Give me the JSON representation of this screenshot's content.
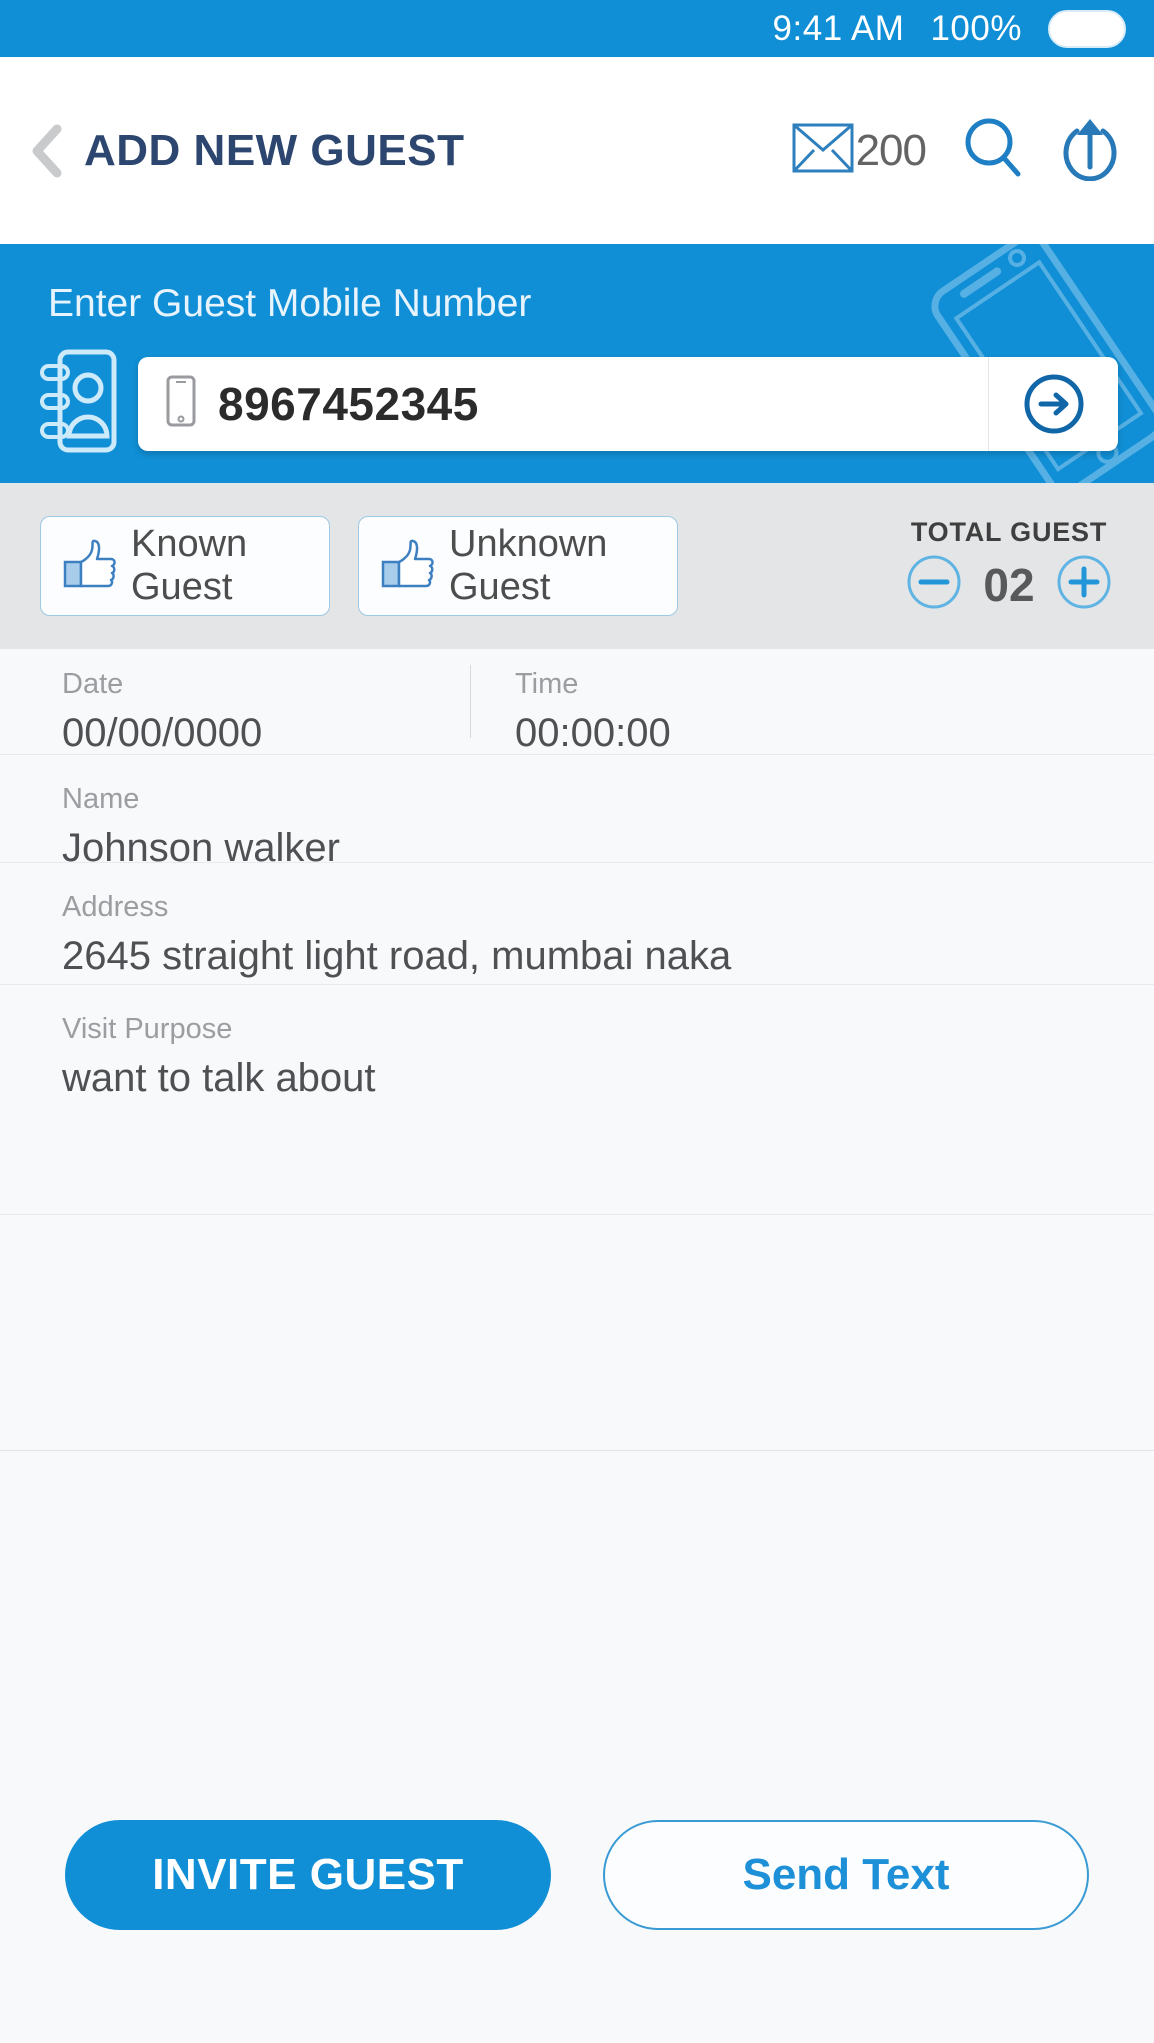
{
  "status_bar": {
    "time": "9:41 AM",
    "battery_percent": "100%",
    "battery_icon": "battery-full-icon",
    "background_color": "#108fd6"
  },
  "header": {
    "back_icon": "back-chevron-icon",
    "title": "ADD NEW GUEST",
    "title_color": "#2c4670",
    "mail_icon": "envelope-icon",
    "mail_count": "200",
    "search_icon": "search-icon",
    "share_icon": "upload-share-icon"
  },
  "mobile_panel": {
    "background_color": "#108fd6",
    "label": "Enter Guest Mobile Number",
    "contact_book_icon": "contact-book-icon",
    "phone_decoration_icon": "tilted-phone-outline-icon",
    "input_icon": "mobile-phone-icon",
    "input_value": "8967452345",
    "input_placeholder": "Enter Guest Mobile Number",
    "submit_icon": "arrow-right-circle-icon"
  },
  "guest_type": {
    "background_color": "#e4e5e7",
    "known_icon": "thumbs-up-icon",
    "known_label": "Known Guest",
    "unknown_icon": "thumbs-up-icon",
    "unknown_label": "Unknown Guest",
    "counter_title": "TOTAL GUEST",
    "decrement_icon": "minus-circle-icon",
    "counter_value": "02",
    "increment_icon": "plus-circle-icon"
  },
  "form": {
    "date": {
      "label": "Date",
      "value": "00/00/0000"
    },
    "time": {
      "label": "Time",
      "value": "00:00:00"
    },
    "name": {
      "label": "Name",
      "value": "Johnson walker"
    },
    "address": {
      "label": "Address",
      "value": "2645 straight light road, mumbai naka"
    },
    "visit_purpose": {
      "label": "Visit Purpose",
      "value": "want to talk about"
    }
  },
  "bottom_actions": {
    "primary_label": "INVITE GUEST",
    "primary_color": "#108fd6",
    "secondary_label": "Send Text",
    "secondary_color": "#1e90d8"
  }
}
